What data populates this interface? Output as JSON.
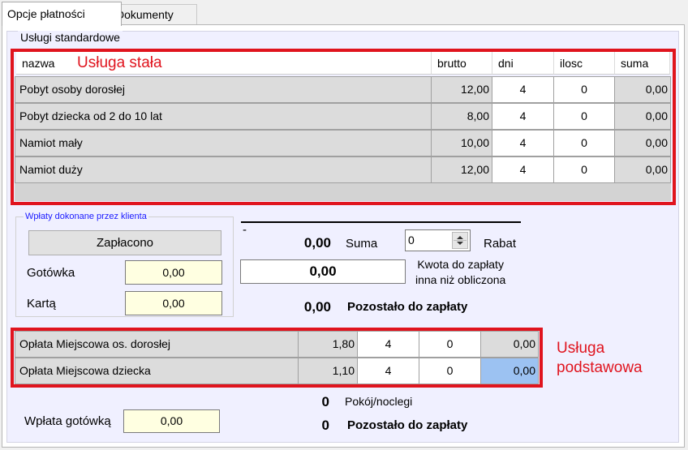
{
  "tabs": [
    {
      "label": "Opcje płatności",
      "active": true
    },
    {
      "label": "Dokumenty",
      "active": false
    }
  ],
  "group_title": "Usługi standardowe",
  "services_table": {
    "headers": {
      "name": "nazwa",
      "brutto": "brutto",
      "dni": "dni",
      "ilosc": "ilosc",
      "suma": "suma"
    },
    "rows": [
      {
        "name": "Pobyt osoby dorosłej",
        "brutto": "12,00",
        "dni": "4",
        "ilosc": "0",
        "suma": "0,00"
      },
      {
        "name": "Pobyt dziecka od 2 do 10 lat",
        "brutto": "8,00",
        "dni": "4",
        "ilosc": "0",
        "suma": "0,00"
      },
      {
        "name": "Namiot mały",
        "brutto": "10,00",
        "dni": "4",
        "ilosc": "0",
        "suma": "0,00"
      },
      {
        "name": "Namiot duży",
        "brutto": "12,00",
        "dni": "4",
        "ilosc": "0",
        "suma": "0,00"
      }
    ]
  },
  "annotation_fixed": "Usługa stała",
  "annotation_basic": "Usługa\npodstawowa",
  "payments": {
    "title": "Wpłaty dokonane przez klienta",
    "paid_button": "Zapłacono",
    "cash_label": "Gotówka",
    "cash_value": "0,00",
    "card_label": "Kartą",
    "card_value": "0,00"
  },
  "summary": {
    "dash": "-",
    "sum_value": "0,00",
    "sum_label": "Suma",
    "discount_value": "0",
    "discount_label": "Rabat",
    "custom_amount_value": "0,00",
    "custom_amount_label": "Kwota do zapłaty\ninna niż obliczona",
    "remaining_value": "0,00",
    "remaining_label": "Pozostało do zapłaty"
  },
  "basic_table": {
    "rows": [
      {
        "name": "Opłata Miejscowa os. dorosłej",
        "brutto": "1,80",
        "dni": "4",
        "ilosc": "0",
        "suma": "0,00"
      },
      {
        "name": "Opłata Miejscowa dziecka",
        "brutto": "1,10",
        "dni": "4",
        "ilosc": "0",
        "suma": "0,00",
        "selected": true
      }
    ]
  },
  "footer": {
    "rooms_value": "0",
    "rooms_label": "Pokój/noclegi",
    "cash_deposit_label": "Wpłata gotówką",
    "cash_deposit_value": "0,00",
    "remaining_value": "0",
    "remaining_label": "Pozostało do zapłaty"
  },
  "colors": {
    "annotation": "#e0141e",
    "selected_cell": "#9cc2f2",
    "input_yellow": "#ffffe1"
  }
}
